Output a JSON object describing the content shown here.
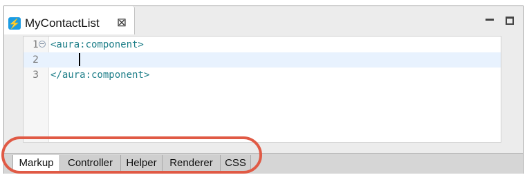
{
  "editor_tab": {
    "icon": "lightning-bolt-icon",
    "icon_glyph": "⚡",
    "title": "MyContactList",
    "close_icon": "close-icon",
    "close_glyph": "⊠"
  },
  "window_controls": {
    "minimize_icon": "minimize-icon",
    "maximize_icon": "maximize-icon"
  },
  "code": {
    "lines": [
      {
        "number": "1",
        "text": "<aura:component>",
        "foldable": true,
        "current": false
      },
      {
        "number": "2",
        "text": "",
        "foldable": false,
        "current": true
      },
      {
        "number": "3",
        "text": "</aura:component>",
        "foldable": false,
        "current": false
      }
    ]
  },
  "bottom_tabs": [
    {
      "label": "Markup",
      "active": true
    },
    {
      "label": "Controller",
      "active": false
    },
    {
      "label": "Helper",
      "active": false
    },
    {
      "label": "Renderer",
      "active": false
    },
    {
      "label": "CSS",
      "active": false
    }
  ],
  "colors": {
    "code_text": "#1f7f89",
    "current_line": "#e8f2fe",
    "highlight_ring": "#e05a45",
    "tab_icon_bg": "#1c9ce3"
  }
}
